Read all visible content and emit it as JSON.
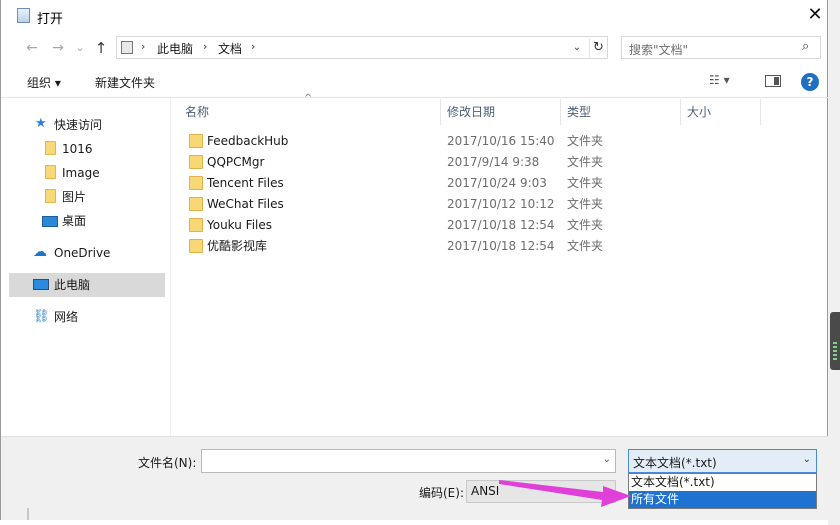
{
  "window": {
    "title": "打开",
    "close_glyph": "✕"
  },
  "nav": {
    "back_glyph": "←",
    "forward_glyph": "→",
    "recent_glyph": "⌄",
    "up_glyph": "↑"
  },
  "address": {
    "segments": [
      "此电脑",
      "文档"
    ],
    "chevron": "›",
    "dropdown_glyph": "⌄",
    "refresh_glyph": "↻"
  },
  "search": {
    "placeholder": "搜索\"文档\"",
    "icon_glyph": "⌕"
  },
  "toolbar": {
    "organize": "组织 ▾",
    "new_folder": "新建文件夹",
    "view_glyph": "☷ ▾",
    "help_glyph": "?"
  },
  "sidebar": {
    "items": [
      {
        "label": "快速访问",
        "icon": "star-icon"
      },
      {
        "label": "1016",
        "icon": "folder-icon"
      },
      {
        "label": "Image",
        "icon": "folder-icon"
      },
      {
        "label": "图片",
        "icon": "folder-icon"
      },
      {
        "label": "桌面",
        "icon": "desktop-icon"
      },
      {
        "label": "OneDrive",
        "icon": "cloud-icon"
      },
      {
        "label": "此电脑",
        "icon": "computer-icon",
        "selected": true
      },
      {
        "label": "网络",
        "icon": "network-icon"
      }
    ],
    "star_glyph": "★",
    "cloud_glyph": "☁",
    "network_glyph": "⛓"
  },
  "columns": {
    "name": "名称",
    "modified": "修改日期",
    "type": "类型",
    "size": "大小",
    "sort_glyph": "^"
  },
  "files": [
    {
      "name": "FeedbackHub",
      "modified": "2017/10/16 15:40",
      "type": "文件夹"
    },
    {
      "name": "QQPCMgr",
      "modified": "2017/9/14 9:38",
      "type": "文件夹"
    },
    {
      "name": "Tencent Files",
      "modified": "2017/10/24 9:03",
      "type": "文件夹"
    },
    {
      "name": "WeChat Files",
      "modified": "2017/10/12 10:12",
      "type": "文件夹"
    },
    {
      "name": "Youku Files",
      "modified": "2017/10/18 12:54",
      "type": "文件夹"
    },
    {
      "name": "优酷影视库",
      "modified": "2017/10/18 12:54",
      "type": "文件夹"
    }
  ],
  "bottom": {
    "filename_label": "文件名(N):",
    "filename_value": "",
    "dropdown_glyph": "⌄",
    "filter_selected": "文本文档(*.txt)",
    "encoding_label": "编码(E):",
    "encoding_value": "ANSI",
    "filter_options": [
      "文本文档(*.txt)",
      "所有文件"
    ],
    "highlighted_option": 1
  },
  "colors": {
    "accent": "#1f72d0",
    "annotation_arrow": "#e040d8",
    "folder": "#f8d876"
  }
}
